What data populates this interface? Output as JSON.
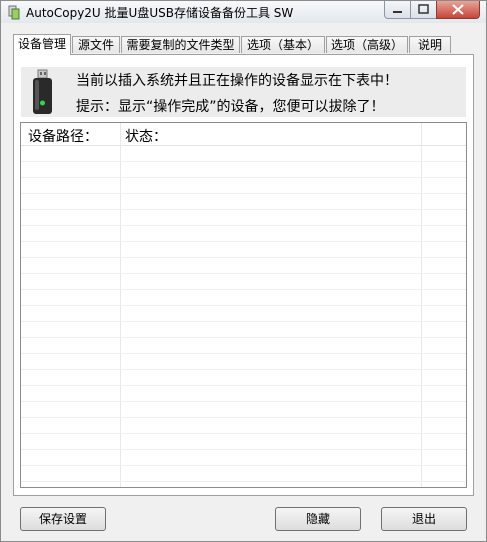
{
  "window": {
    "title": "AutoCopy2U 批量U盘USB存储设备备份工具 SW"
  },
  "tabs": [
    {
      "label": "设备管理",
      "active": true
    },
    {
      "label": "源文件"
    },
    {
      "label": "需要复制的文件类型"
    },
    {
      "label": "选项（基本）"
    },
    {
      "label": "选项（高级）"
    },
    {
      "label": "说明"
    }
  ],
  "info": {
    "line1": "当前以插入系统并且正在操作的设备显示在下表中！",
    "line2": "提示：显示“操作完成”的设备，您便可以拔除了！",
    "icon": "usb-drive-icon"
  },
  "device_list": {
    "columns": [
      "设备路径：",
      "状态："
    ],
    "rows": []
  },
  "buttons": {
    "save": "保存设置",
    "hide": "隐藏",
    "exit": "退出"
  }
}
